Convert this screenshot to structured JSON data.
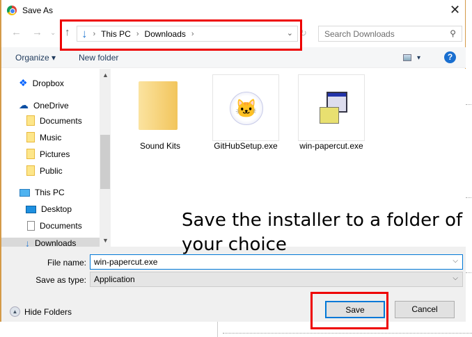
{
  "window": {
    "title": "Save As",
    "close": "✕"
  },
  "nav": {
    "back": "←",
    "forward": "→",
    "recent": "⌄",
    "up": "↑"
  },
  "address": {
    "crumbs": [
      "This PC",
      "Downloads"
    ],
    "sep": "›"
  },
  "search": {
    "placeholder": "Search Downloads"
  },
  "toolbar": {
    "organize": "Organize ▾",
    "new_folder": "New folder",
    "view_dd": "▾",
    "help": "?"
  },
  "sidebar": {
    "items": [
      {
        "label": "Dropbox",
        "icon": "dropbox-icon"
      },
      {
        "label": "OneDrive",
        "icon": "onedrive-icon"
      },
      {
        "label": "Documents",
        "icon": "folder-icon"
      },
      {
        "label": "Music",
        "icon": "folder-icon"
      },
      {
        "label": "Pictures",
        "icon": "folder-icon"
      },
      {
        "label": "Public",
        "icon": "folder-icon"
      },
      {
        "label": "This PC",
        "icon": "computer-icon"
      },
      {
        "label": "Desktop",
        "icon": "desktop-icon"
      },
      {
        "label": "Documents",
        "icon": "document-icon"
      },
      {
        "label": "Downloads",
        "icon": "download-icon",
        "selected": true
      }
    ]
  },
  "files": [
    {
      "name": "Sound Kits",
      "icon": "folder-icon"
    },
    {
      "name": "GitHubSetup.exe",
      "icon": "github-icon"
    },
    {
      "name": "win-papercut.exe",
      "icon": "installer-icon"
    }
  ],
  "form": {
    "file_name_label": "File name:",
    "file_name": "win-papercut.exe",
    "type_label": "Save as type:",
    "type": "Application"
  },
  "buttons": {
    "hide_folders": "Hide Folders",
    "save": "Save",
    "cancel": "Cancel"
  },
  "annotation": "Save the installer to a folder of your choice",
  "colors": {
    "highlight": "#e00000",
    "accent": "#0078d7",
    "border": "#d49a48"
  }
}
